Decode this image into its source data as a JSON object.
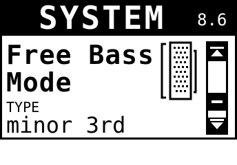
{
  "header": {
    "title": "SYSTEM",
    "page_number": "8.6"
  },
  "parameter": {
    "line1": "Free Bass",
    "line2": "Mode"
  },
  "type": {
    "label": "TYPE",
    "value": "minor 3rd"
  },
  "icons": {
    "board": "bass-button-board-icon",
    "scroll_up": "scroll-up-arrow-icon",
    "scroll_down": "scroll-down-arrow-icon"
  },
  "colors": {
    "background": "#ffffff",
    "foreground": "#000000"
  }
}
